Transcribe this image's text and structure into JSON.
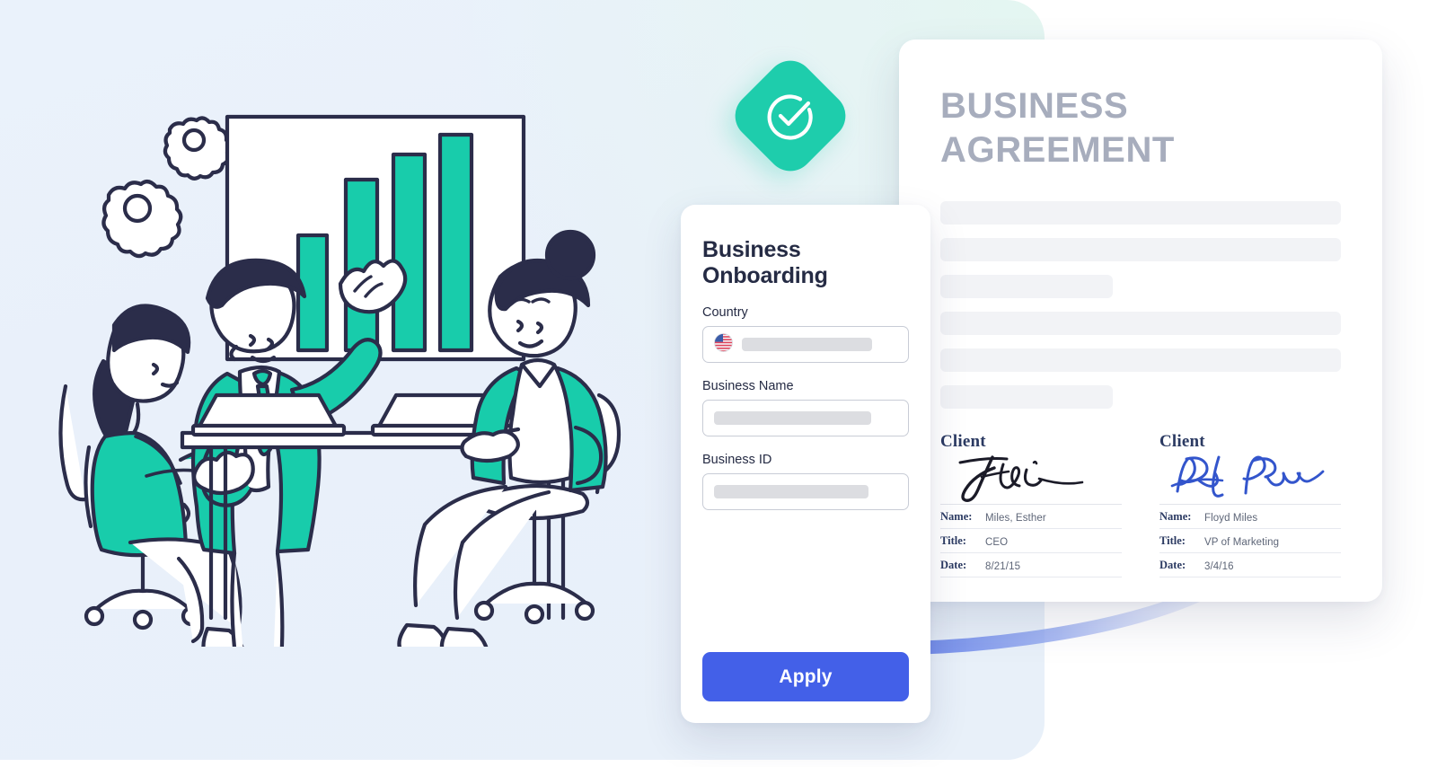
{
  "theme": {
    "teal": "#1ecdac",
    "navy": "#2b2d4a",
    "accent_blue": "#4360e8",
    "doc_title_gray": "#a7adbd",
    "panel_bg_blue": "#e9f0fa",
    "panel_bg_mint": "#e4f6f1",
    "signature_blue": "#3355cc"
  },
  "badge": {
    "icon": "check-circle-icon"
  },
  "illustration": {
    "name": "business-team-meeting-illustration",
    "gear_icons": [
      "gear-icon",
      "gear-icon"
    ],
    "whiteboard": {
      "name": "whiteboard-bar-chart",
      "bars": [
        25,
        55,
        75,
        88
      ]
    }
  },
  "form": {
    "title": "Business Onboarding",
    "fields": [
      {
        "label": "Country",
        "name": "country-field",
        "icon": "us-flag-icon",
        "value": ""
      },
      {
        "label": "Business Name",
        "name": "business-name-field",
        "value": ""
      },
      {
        "label": "Business ID",
        "name": "business-id-field",
        "value": ""
      }
    ],
    "submit_label": "Apply"
  },
  "document": {
    "title": "BUSINESS AGREEMENT",
    "body_lines": [
      "full",
      "full",
      "short",
      "full",
      "full",
      "short"
    ],
    "signatories": [
      {
        "heading": "Client",
        "signature_color": "#1b1b28",
        "rows": [
          {
            "label": "Name:",
            "value": "Miles, Esther"
          },
          {
            "label": "Title:",
            "value": "CEO"
          },
          {
            "label": "Date:",
            "value": "8/21/15"
          }
        ]
      },
      {
        "heading": "Client",
        "signature_color": "#3355cc",
        "rows": [
          {
            "label": "Name:",
            "value": "Floyd Miles"
          },
          {
            "label": "Title:",
            "value": "VP of Marketing"
          },
          {
            "label": "Date:",
            "value": "3/4/16"
          }
        ]
      }
    ]
  }
}
